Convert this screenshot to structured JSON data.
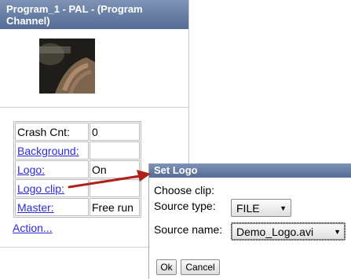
{
  "panel": {
    "title": "Program_1 - PAL - (Program Channel)",
    "properties": [
      {
        "label": "Crash Cnt:",
        "value": "0",
        "link": false
      },
      {
        "label": "Background:",
        "value": "",
        "link": true
      },
      {
        "label": "Logo:",
        "value": "On",
        "link": true
      },
      {
        "label": "Logo clip:",
        "value": "",
        "link": true
      },
      {
        "label": "Master:",
        "value": "Free run",
        "link": true
      }
    ],
    "action_label": "Action..."
  },
  "dialog": {
    "title": "Set Logo",
    "choose_clip_label": "Choose clip:",
    "source_type_label": "Source type:",
    "source_type_value": "FILE",
    "source_name_label": "Source name:",
    "source_name_value": "Demo_Logo.avi",
    "ok_label": "Ok",
    "cancel_label": "Cancel"
  },
  "colors": {
    "header_gradient_top": "#7e93b5",
    "header_gradient_bottom": "#546b94",
    "link": "#2b2bd6",
    "annotation_arrow": "#b0201a"
  },
  "icons": {
    "dropdown": "triangle-down"
  }
}
